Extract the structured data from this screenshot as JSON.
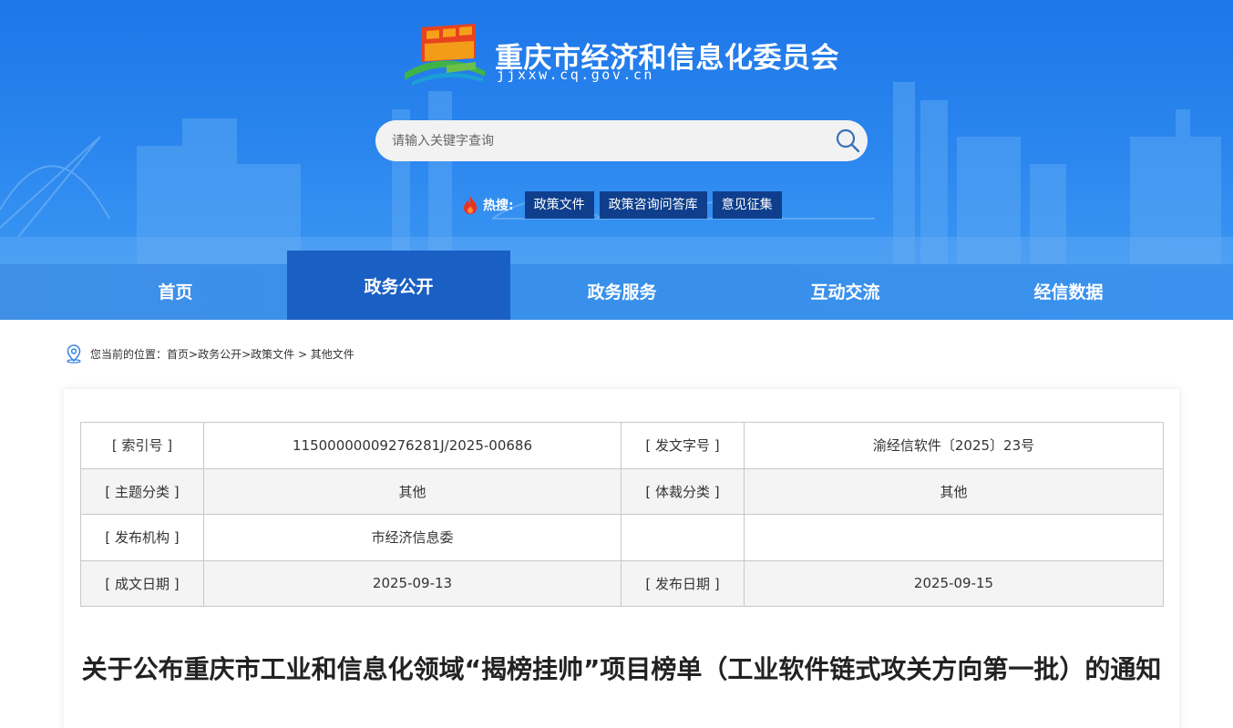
{
  "header": {
    "site_title": "重庆市经济和信息化委员会",
    "site_domain": "jjxxw.cq.gov.cn",
    "search_placeholder": "请输入关键字查询",
    "hot_label": "热搜:",
    "hot_tags": [
      "政策文件",
      "政策咨询问答库",
      "意见征集"
    ]
  },
  "nav": {
    "items": [
      "首页",
      "政务公开",
      "政务服务",
      "互动交流",
      "经信数据"
    ],
    "active_index": 1
  },
  "breadcrumb": {
    "prefix": "您当前的位置：",
    "path": "首页>政务公开>政策文件 > 其他文件"
  },
  "meta": {
    "rows": [
      {
        "label1": "[ 索引号 ]",
        "value1": "11500000009276281J/2025-00686",
        "label2": "[ 发文字号 ]",
        "value2": "渝经信软件〔2025〕23号"
      },
      {
        "label1": "[ 主题分类 ]",
        "value1": "其他",
        "label2": "[ 体裁分类 ]",
        "value2": "其他"
      },
      {
        "label1": "[ 发布机构 ]",
        "value1": "市经济信息委",
        "label2": "",
        "value2": ""
      },
      {
        "label1": "[ 成文日期 ]",
        "value1": "2025-09-13",
        "label2": "[ 发布日期 ]",
        "value2": "2025-09-15"
      }
    ]
  },
  "document": {
    "title": "关于公布重庆市工业和信息化领域“揭榜挂帅”项目榜单（工业软件链式攻关方向第一批）的通知"
  },
  "colors": {
    "header_blue": "#2a86ee",
    "nav_active": "#1a5fc4",
    "hot_tag_bg": "#0f3f8c"
  }
}
